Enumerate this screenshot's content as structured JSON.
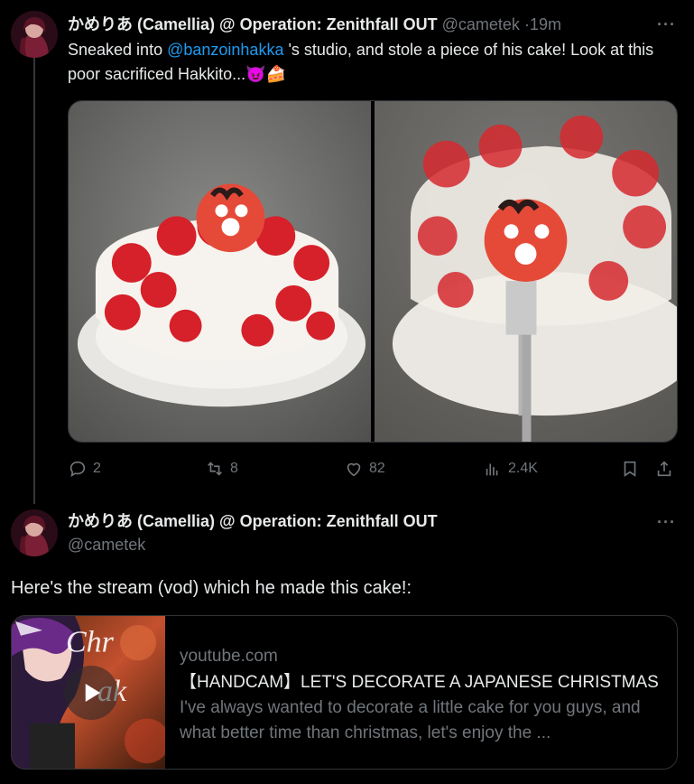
{
  "tweet1": {
    "name": "かめりあ (Camellia) @ Operation: Zenithfall OUT",
    "handle": "@cametek",
    "separator": "·",
    "time": "19m",
    "more": "···",
    "text_before": "Sneaked into ",
    "mention": "@banzoinhakka",
    "text_after": " 's studio, and stole a piece of his cake! Look at this poor sacrificed Hakkito...😈🍰",
    "actions": {
      "replies": "2",
      "reposts": "8",
      "likes": "82",
      "views": "2.4K"
    }
  },
  "tweet2": {
    "name": "かめりあ (Camellia) @ Operation: Zenithfall OUT",
    "handle": "@cametek",
    "more": "···",
    "text": "Here's the stream (vod) which he made this cake!:",
    "card": {
      "domain": "youtube.com",
      "title": "【HANDCAM】LET'S DECORATE A JAPANESE CHRISTMAS CAKE",
      "description": "I've always wanted to decorate a little cake for you guys, and what better time than christmas, let's enjoy the ..."
    }
  },
  "colors": {
    "background": "#000000",
    "text": "#e7e9ea",
    "secondary": "#71767b",
    "accent": "#1d9bf0",
    "border": "#2f3336"
  },
  "icons": [
    "more-icon",
    "reply-icon",
    "repost-icon",
    "like-icon",
    "views-icon",
    "bookmark-icon",
    "share-icon",
    "play-icon"
  ]
}
